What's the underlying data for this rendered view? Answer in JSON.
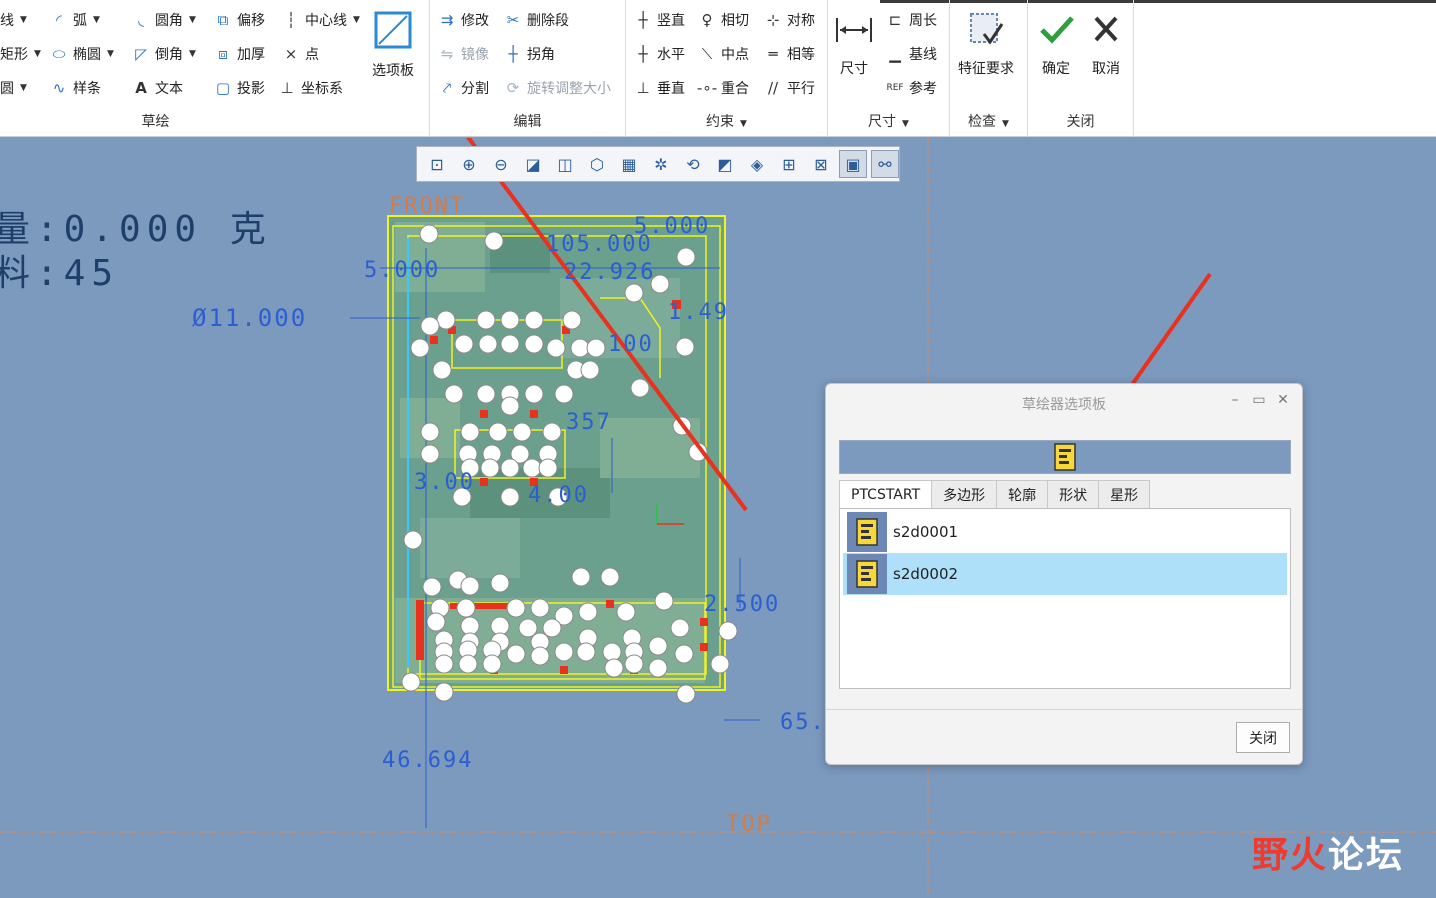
{
  "ribbon": {
    "groups": {
      "sketch": "草绘",
      "edit": "编辑",
      "constrain": "约束",
      "dimension": "尺寸",
      "inspect": "检查",
      "close": "关闭"
    },
    "sketch_tools": {
      "line": "线",
      "arc": "弧",
      "fillet": "圆角",
      "offset": "偏移",
      "centerline": "中心线",
      "rect": "矩形",
      "ellipse": "椭圆",
      "chamfer": "倒角",
      "thicken": "加厚",
      "point": "点",
      "circle": "圆",
      "spline": "样条",
      "text": "文本",
      "project": "投影",
      "coordsys": "坐标系",
      "palette": "选项板"
    },
    "edit_tools": {
      "modify": "修改",
      "delete_segment": "删除段",
      "mirror": "镜像",
      "corner": "拐角",
      "divide": "分割",
      "rotate_resize": "旋转调整大小"
    },
    "constrain_tools": {
      "vertical": "竖直",
      "tangent": "相切",
      "symmetric": "对称",
      "horizontal": "水平",
      "midpoint": "中点",
      "equal": "相等",
      "perpendicular": "垂直",
      "coincident": "重合",
      "parallel": "平行"
    },
    "dimension_tools": {
      "dimension": "尺寸",
      "perimeter": "周长",
      "baseline": "基线",
      "reference": "参考"
    },
    "inspect_tools": {
      "feature_requirements": "特征要求"
    },
    "close_tools": {
      "ok": "确定",
      "cancel": "取消"
    }
  },
  "canvas": {
    "mass_text": "量:0.000 克",
    "material_text": "料:45",
    "front_label": "FRONT",
    "top_label": "TOP",
    "dims": [
      "5.000",
      "105.000",
      "22.926",
      "5.000",
      "Ø11.000",
      "1.49",
      "100",
      "357",
      "3.00",
      "4.00",
      "2.500",
      "46.694",
      "65."
    ]
  },
  "dialog": {
    "title": "草绘器选项板",
    "tabs": [
      "PTCSTART",
      "多边形",
      "轮廓",
      "形状",
      "星形"
    ],
    "items": [
      "s2d0001",
      "s2d0002"
    ],
    "selected_index": 1,
    "close_label": "关闭"
  },
  "watermark": {
    "part1": "野火",
    "part2": "论坛"
  },
  "colors": {
    "canvas_bg": "#7c99be",
    "sketch_yellow": "#f2f21e",
    "dim_blue": "#2b5fd1",
    "annotation_red": "#e8321e",
    "selection": "#aee0fa"
  }
}
